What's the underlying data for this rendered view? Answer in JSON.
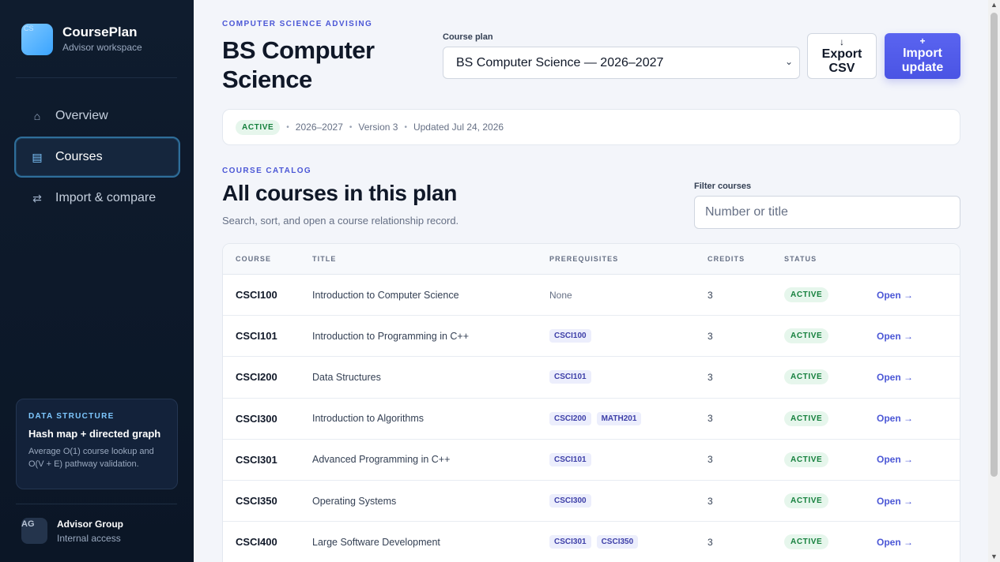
{
  "brand": {
    "logo_text": "CS",
    "title": "CoursePlan",
    "subtitle": "Advisor workspace"
  },
  "nav": {
    "items": [
      {
        "icon": "home-icon",
        "glyph": "⌂",
        "label": "Overview",
        "active": false
      },
      {
        "icon": "list-icon",
        "glyph": "▤",
        "label": "Courses",
        "active": true
      },
      {
        "icon": "swap-icon",
        "glyph": "⇄",
        "label": "Import & compare",
        "active": false
      }
    ]
  },
  "data_structure_card": {
    "kicker": "DATA STRUCTURE",
    "title": "Hash map + directed graph",
    "body": "Average O(1) course lookup and O(V + E) pathway validation."
  },
  "user": {
    "initials": "AG",
    "name": "Advisor Group",
    "access": "Internal access"
  },
  "header": {
    "kicker": "COMPUTER SCIENCE ADVISING",
    "title": "BS Computer Science",
    "plan_label": "Course plan",
    "plan_selected": "BS Computer Science — 2026–2027",
    "export_label": "Export CSV",
    "export_icon": "↓",
    "import_label": "Import update",
    "import_icon": "+"
  },
  "meta": {
    "status": "ACTIVE",
    "year": "2026–2027",
    "version": "Version 3",
    "updated": "Updated Jul 24, 2026"
  },
  "catalog": {
    "kicker": "COURSE CATALOG",
    "title": "All courses in this plan",
    "subtitle": "Search, sort, and open a course relationship record.",
    "filter_label": "Filter courses",
    "filter_placeholder": "Number or title"
  },
  "table": {
    "headers": {
      "course": "COURSE",
      "title": "TITLE",
      "prereqs": "PREREQUISITES",
      "credits": "CREDITS",
      "status": "STATUS"
    },
    "rows": [
      {
        "course": "CSCI100",
        "title": "Introduction to Computer Science",
        "prereqs": [],
        "none_text": "None",
        "credits": "3",
        "status": "ACTIVE",
        "action": "Open →"
      },
      {
        "course": "CSCI101",
        "title": "Introduction to Programming in C++",
        "prereqs": [
          "CSCI100"
        ],
        "credits": "3",
        "status": "ACTIVE",
        "action": "Open →"
      },
      {
        "course": "CSCI200",
        "title": "Data Structures",
        "prereqs": [
          "CSCI101"
        ],
        "credits": "3",
        "status": "ACTIVE",
        "action": "Open →"
      },
      {
        "course": "CSCI300",
        "title": "Introduction to Algorithms",
        "prereqs": [
          "CSCI200",
          "MATH201"
        ],
        "credits": "3",
        "status": "ACTIVE",
        "action": "Open →"
      },
      {
        "course": "CSCI301",
        "title": "Advanced Programming in C++",
        "prereqs": [
          "CSCI101"
        ],
        "credits": "3",
        "status": "ACTIVE",
        "action": "Open →"
      },
      {
        "course": "CSCI350",
        "title": "Operating Systems",
        "prereqs": [
          "CSCI300"
        ],
        "credits": "3",
        "status": "ACTIVE",
        "action": "Open →"
      },
      {
        "course": "CSCI400",
        "title": "Large Software Development",
        "prereqs": [
          "CSCI301",
          "CSCI350"
        ],
        "credits": "3",
        "status": "ACTIVE",
        "action": "Open →"
      }
    ]
  },
  "colors": {
    "accent": "#4b57d6",
    "sidebar_bg": "#0f1c2e",
    "status_green": "#15803d"
  }
}
